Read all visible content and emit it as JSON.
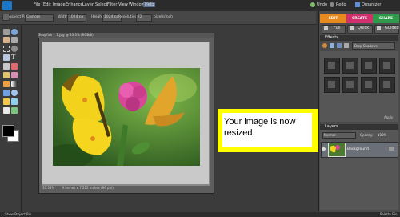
{
  "menu": {
    "items": [
      "File",
      "Edit",
      "Image",
      "Enhance",
      "Layer",
      "Select",
      "Filter",
      "View",
      "Window",
      "Help"
    ],
    "active": "Help",
    "undo": "Undo",
    "redo": "Redo",
    "organizer": "Organizer"
  },
  "options_bar": {
    "aspect_ratio_label": "Aspect Ratio:",
    "aspect_ratio_value": "Custom",
    "width_label": "Width:",
    "width_value": "1024 px",
    "height_label": "Height:",
    "height_value": "1024 px",
    "resolution_label": "Resolution:",
    "resolution_value": "72",
    "resolution_unit": "pixels/inch"
  },
  "document": {
    "title": "Snapfish™ 1.jpg @ 33.3% (RGB/8)",
    "zoom": "33.33%",
    "info": "9 inches x 7.222 inches (96 ppi)"
  },
  "callout": {
    "text": "Your image is now resized."
  },
  "right_panel": {
    "tabs": [
      "EDIT",
      "CREATE",
      "SHARE"
    ],
    "tab_colors": [
      "#e8891d",
      "#d22f6e",
      "#2f9a4a"
    ],
    "modes": [
      "Full",
      "Quick",
      "Guided"
    ],
    "effects_header": "Effects",
    "effects_dropdown": "Drop Shadows",
    "apply_label": "Apply",
    "layers_header": "Layers",
    "blend_mode": "Normal",
    "opacity_label": "Opacity:",
    "opacity_value": "100%",
    "layer_name": "Background"
  },
  "bottom": {
    "project_bin": "Show Project Bin",
    "palette_bin": "Palette Bin"
  },
  "icons": [
    "logo-icon",
    "undo-icon",
    "redo-icon",
    "organizer-icon",
    "move-tool-icon",
    "zoom-tool-icon",
    "hand-tool-icon",
    "eyedropper-icon",
    "marquee-icon",
    "lasso-icon",
    "magic-wand-icon",
    "type-tool-icon",
    "crop-tool-icon",
    "brush-icon",
    "eraser-icon",
    "paint-bucket-icon",
    "gradient-icon",
    "shape-tool-icon",
    "blur-icon",
    "sponge-icon",
    "eye-icon",
    "lock-icon"
  ],
  "colors": {
    "callout_border": "#ffff00",
    "app_bg": "#3a3a3a",
    "highlight_layer": "#6b6f78"
  }
}
